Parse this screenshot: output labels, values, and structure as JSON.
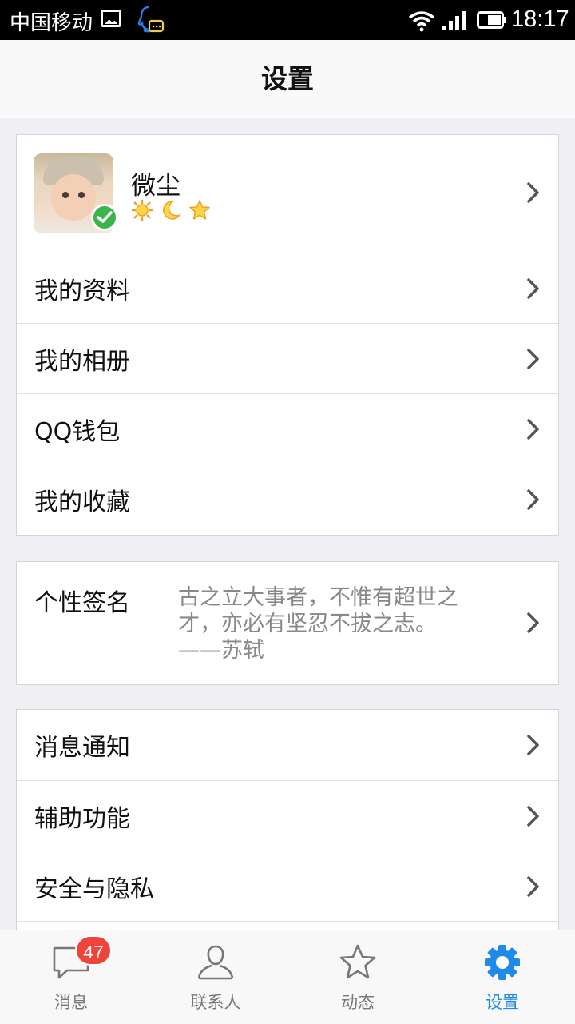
{
  "status_bar": {
    "carrier": "中国移动",
    "time": "18:17",
    "icons": [
      "image-icon",
      "qq-notification-icon",
      "wifi-icon",
      "signal-icon",
      "battery-icon"
    ]
  },
  "header": {
    "title": "设置"
  },
  "profile": {
    "nickname": "微尘",
    "level_icons": [
      "sun-icon",
      "moon-icon",
      "star-icon"
    ],
    "verified": true
  },
  "group1": {
    "items": [
      {
        "label": "我的资料"
      },
      {
        "label": "我的相册"
      },
      {
        "label": "QQ钱包"
      },
      {
        "label": "我的收藏"
      }
    ]
  },
  "signature": {
    "label": "个性签名",
    "text": "古之立大事者，不惟有超世之才，亦必有坚忍不拔之志。——苏轼"
  },
  "group3": {
    "items": [
      {
        "label": "消息通知"
      },
      {
        "label": "辅助功能"
      },
      {
        "label": "安全与隐私"
      }
    ]
  },
  "tabbar": {
    "tabs": [
      {
        "label": "消息",
        "icon": "chat-bubble-icon",
        "badge": "47"
      },
      {
        "label": "联系人",
        "icon": "person-icon"
      },
      {
        "label": "动态",
        "icon": "star-outline-icon"
      },
      {
        "label": "设置",
        "icon": "gear-icon",
        "active": true
      }
    ]
  },
  "colors": {
    "accent": "#1f8ae8",
    "badge": "#f0433a",
    "verified": "#3bb54a",
    "background": "#efeff4"
  }
}
